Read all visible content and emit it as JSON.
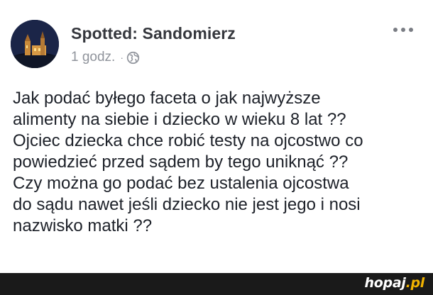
{
  "post": {
    "page_name": "Spotted: Sandomierz",
    "time": "1 godz.",
    "separator": "·",
    "privacy_icon": "globe-icon",
    "more_icon": "more-horizontal-icon",
    "lines": [
      "Jak podać byłego faceta o jak najwyższe",
      "alimenty na siebie i dziecko w wieku 8 lat ??",
      "Ojciec dziecka chce robić testy na ojcostwo co",
      "powiedzieć przed sądem by tego uniknąć ??",
      "Czy można go podać bez ustalenia ojcostwa",
      "do sądu nawet jeśli dziecko nie jest jego i nosi",
      "nazwisko matki ??"
    ]
  },
  "footer": {
    "logo_name": "hopaj",
    "logo_tld": ".pl"
  },
  "colors": {
    "name": "#35373d",
    "meta": "#90949c",
    "text": "#1d2129",
    "footer_bg": "#1a1a1a",
    "logo_accent": "#f2b300"
  }
}
